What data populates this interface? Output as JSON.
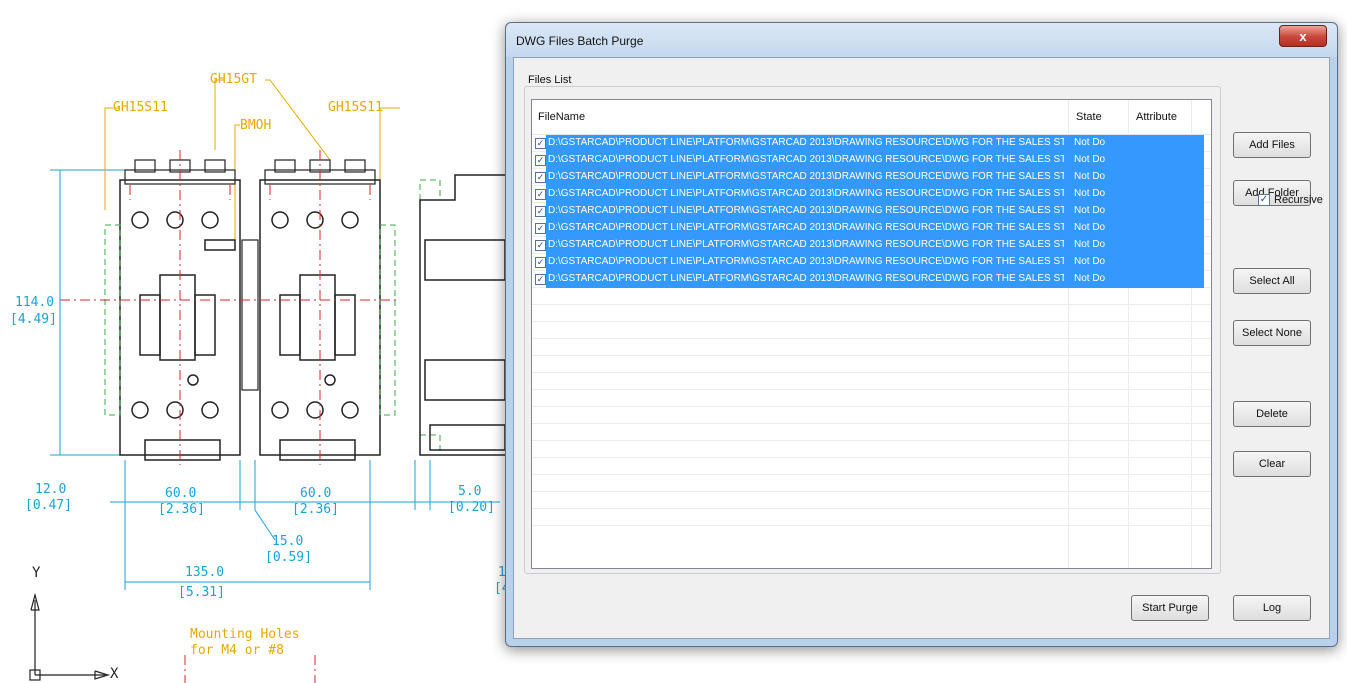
{
  "cad": {
    "labels": {
      "gh15gt": "GH15GT",
      "gh15s11_left": "GH15S11",
      "gh15s11_right": "GH15S11",
      "bmoh": "BMOH",
      "dim_114": "114.0",
      "dim_114_in": "[4.49]",
      "dim_12": "12.0",
      "dim_12_in": "[0.47]",
      "dim_60a": "60.0",
      "dim_60a_in": "[2.36]",
      "dim_60b": "60.0",
      "dim_60b_in": "[2.36]",
      "dim_5": "5.0",
      "dim_5_in": "[0.20]",
      "dim_15": "15.0",
      "dim_15_in": "[0.59]",
      "dim_135": "135.0",
      "dim_135_in": "[5.31]",
      "partial_1": "1",
      "partial_4": "[4",
      "mount_1": "Mounting Holes",
      "mount_2": "for M4 or #8",
      "axis_y": "Y",
      "axis_x": "X"
    }
  },
  "dialog": {
    "title": "DWG Files Batch Purge",
    "close_label": "x",
    "group_label": "Files List",
    "columns": {
      "filename": "FileName",
      "state": "State",
      "attribute": "Attribute"
    },
    "rows": [
      {
        "path": "D:\\GSTARCAD\\PRODUCT LINE\\PLATFORM\\GSTARCAD 2013\\DRAWING RESOURCE\\DWG FOR THE SALES STAF...",
        "state": "Not Do",
        "checked": true
      },
      {
        "path": "D:\\GSTARCAD\\PRODUCT LINE\\PLATFORM\\GSTARCAD 2013\\DRAWING RESOURCE\\DWG FOR THE SALES STAF...",
        "state": "Not Do",
        "checked": true
      },
      {
        "path": "D:\\GSTARCAD\\PRODUCT LINE\\PLATFORM\\GSTARCAD 2013\\DRAWING RESOURCE\\DWG FOR THE SALES STAF...",
        "state": "Not Do",
        "checked": true
      },
      {
        "path": "D:\\GSTARCAD\\PRODUCT LINE\\PLATFORM\\GSTARCAD 2013\\DRAWING RESOURCE\\DWG FOR THE SALES STAF...",
        "state": "Not Do",
        "checked": true
      },
      {
        "path": "D:\\GSTARCAD\\PRODUCT LINE\\PLATFORM\\GSTARCAD 2013\\DRAWING RESOURCE\\DWG FOR THE SALES STAF...",
        "state": "Not Do",
        "checked": true
      },
      {
        "path": "D:\\GSTARCAD\\PRODUCT LINE\\PLATFORM\\GSTARCAD 2013\\DRAWING RESOURCE\\DWG FOR THE SALES STAF...",
        "state": "Not Do",
        "checked": true
      },
      {
        "path": "D:\\GSTARCAD\\PRODUCT LINE\\PLATFORM\\GSTARCAD 2013\\DRAWING RESOURCE\\DWG FOR THE SALES STAF...",
        "state": "Not Do",
        "checked": true
      },
      {
        "path": "D:\\GSTARCAD\\PRODUCT LINE\\PLATFORM\\GSTARCAD 2013\\DRAWING RESOURCE\\DWG FOR THE SALES STAF...",
        "state": "Not Do",
        "checked": true
      },
      {
        "path": "D:\\GSTARCAD\\PRODUCT LINE\\PLATFORM\\GSTARCAD 2013\\DRAWING RESOURCE\\DWG FOR THE SALES STAF...",
        "state": "Not Do",
        "checked": true
      }
    ],
    "buttons": {
      "add_files": "Add Files",
      "add_folder": "Add Folder",
      "recursive": "Recursive",
      "select_all": "Select All",
      "select_none": "Select None",
      "delete": "Delete",
      "clear": "Clear",
      "start_purge": "Start Purge",
      "log": "Log"
    },
    "recursive_checked": true,
    "selection_color": "#3399ff"
  }
}
